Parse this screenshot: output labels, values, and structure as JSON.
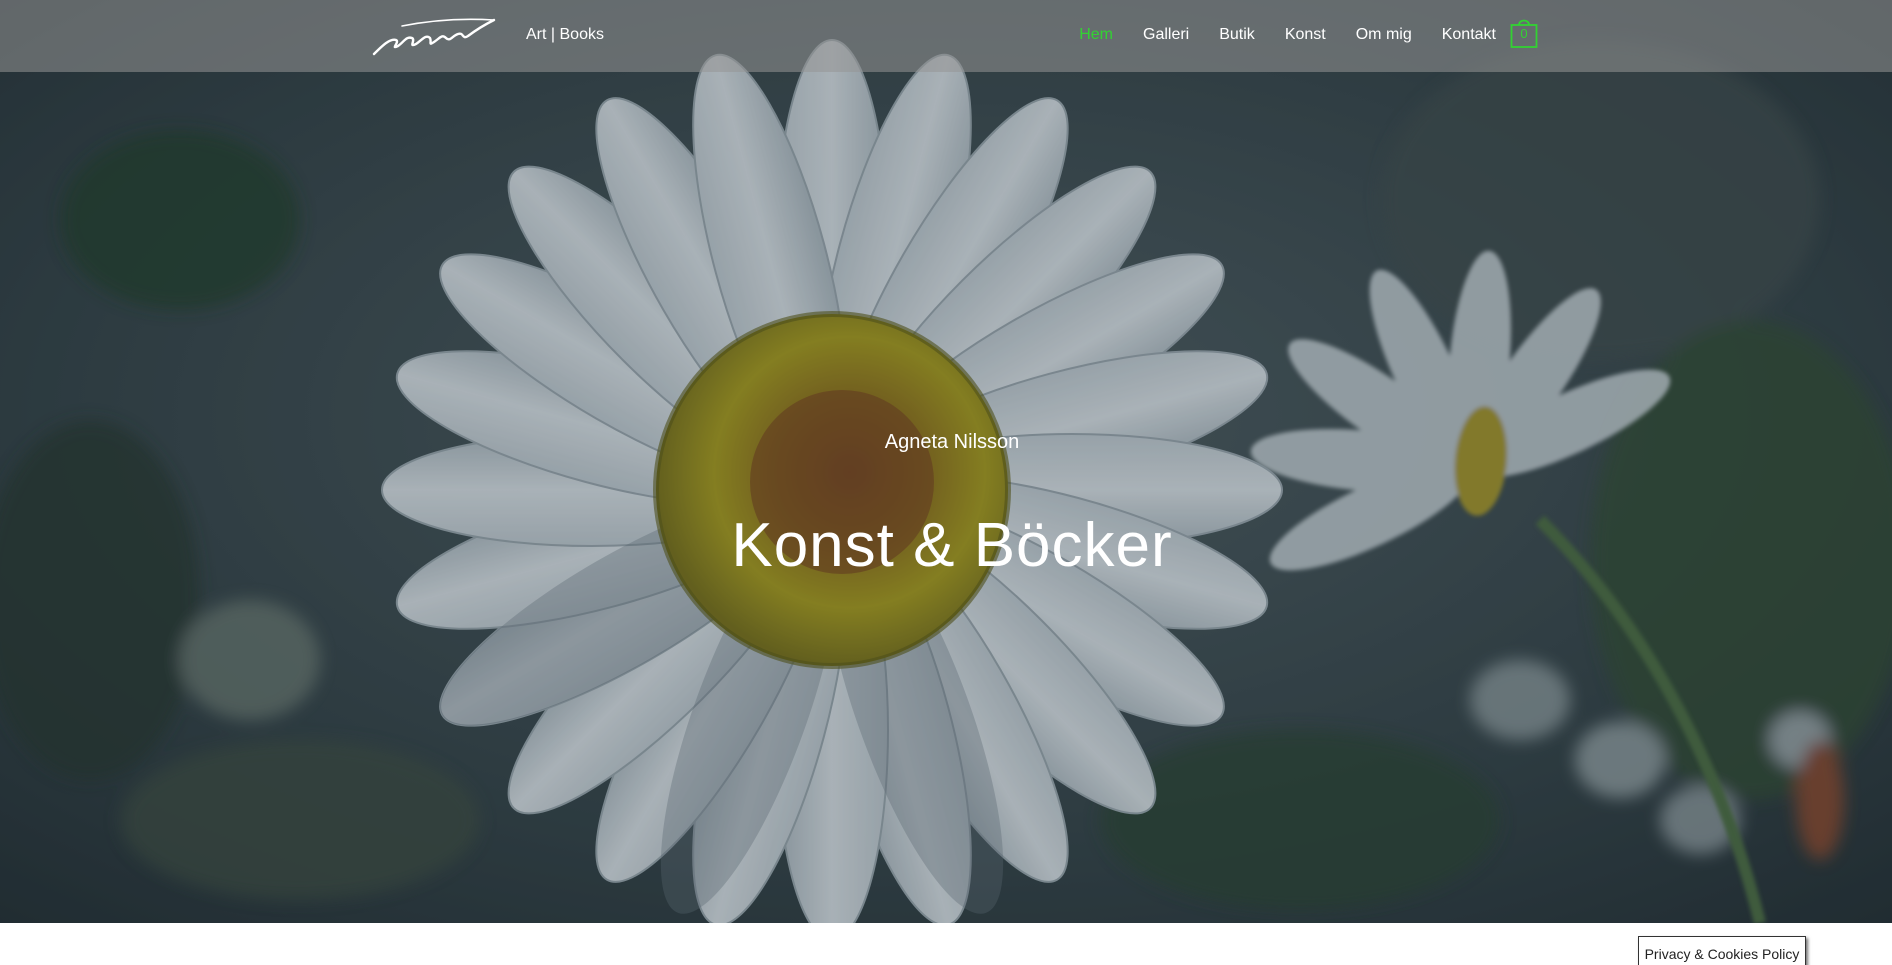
{
  "header": {
    "logo_icon": "agneta-signature-logo",
    "tagline": "Art | Books",
    "nav": [
      {
        "label": "Hem",
        "active": true
      },
      {
        "label": "Galleri",
        "active": false
      },
      {
        "label": "Butik",
        "active": false
      },
      {
        "label": "Konst",
        "active": false
      },
      {
        "label": "Om mig",
        "active": false
      },
      {
        "label": "Kontakt",
        "active": false
      }
    ],
    "cart_icon": "shopping-bag-icon",
    "cart_count": "0",
    "accent_color": "#32d232"
  },
  "hero": {
    "background": "daisy-flower-photo",
    "subtitle": "Agneta Nilsson",
    "title": "Konst & Böcker"
  },
  "cookie_banner": {
    "label": "Privacy & Cookies Policy"
  }
}
